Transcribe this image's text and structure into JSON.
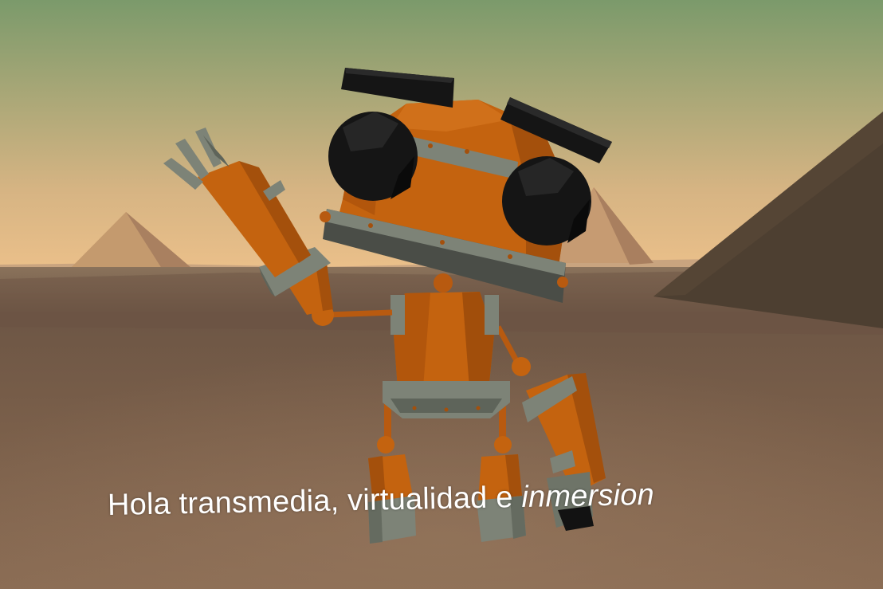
{
  "scene": {
    "subtitle": {
      "main": "Hola transmedia, virtualidad e ",
      "emphasis": "inmersion"
    },
    "colors": {
      "sky_top": "#7b9a6b",
      "sky_horizon": "#e7bd86",
      "ground": "#7a5f4a",
      "robot_orange": "#c5620e",
      "robot_metal": "#7d8377",
      "robot_black": "#121212"
    },
    "objects": [
      "pyramid-left",
      "pyramid-center",
      "pyramid-right",
      "desert-ground",
      "robot-character"
    ]
  }
}
